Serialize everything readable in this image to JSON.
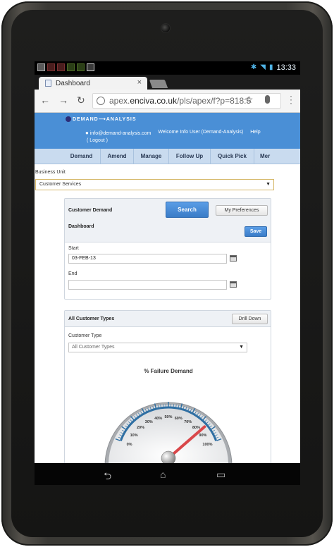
{
  "status_bar": {
    "icons": [
      "notification-icon",
      "app-icon",
      "app-icon",
      "app-icon",
      "app-icon",
      "image-icon"
    ],
    "time": "13:33"
  },
  "browser": {
    "tab_title": "Dashboard",
    "tab_close": "×",
    "url_host_prefix": "apex.",
    "url_host_main": "enciva.co.uk",
    "url_path": "/pls/apex/f?p=818:5"
  },
  "app": {
    "logo_text": "DEMAND⟶ANALYSIS",
    "user_email": "info@demand-analysis.com",
    "welcome": "Welcome Info User (Demand-Analysis)",
    "help": "Help",
    "logout": "( Logout )",
    "menu": [
      "Demand",
      "Amend",
      "Manage",
      "Follow Up",
      "Quick Pick",
      "Mer"
    ],
    "business_unit_label": "Business Unit",
    "business_unit_value": "Customer Services",
    "demand_card": {
      "title_line1": "Customer Demand",
      "title_line2": "Dashboard",
      "search_label": "Search",
      "preferences_label": "My Preferences",
      "save_label": "Save",
      "start_label": "Start",
      "start_value": "03-FEB-13",
      "end_label": "End",
      "end_value": ""
    },
    "types_card": {
      "title": "All Customer Types",
      "drill_down_label": "Drill Down",
      "customer_type_label": "Customer Type",
      "customer_type_value": "All Customer Types",
      "gauge_title": "% Failure Demand"
    }
  },
  "gauge": {
    "min": 0,
    "max": 100,
    "value": 85,
    "ticks": [
      "0%",
      "10%",
      "20%",
      "30%",
      "40%",
      "50%",
      "60%",
      "70%",
      "80%",
      "90%",
      "100%"
    ],
    "needle_color": "#d9474a",
    "arc_color": "#2f6fa3"
  }
}
